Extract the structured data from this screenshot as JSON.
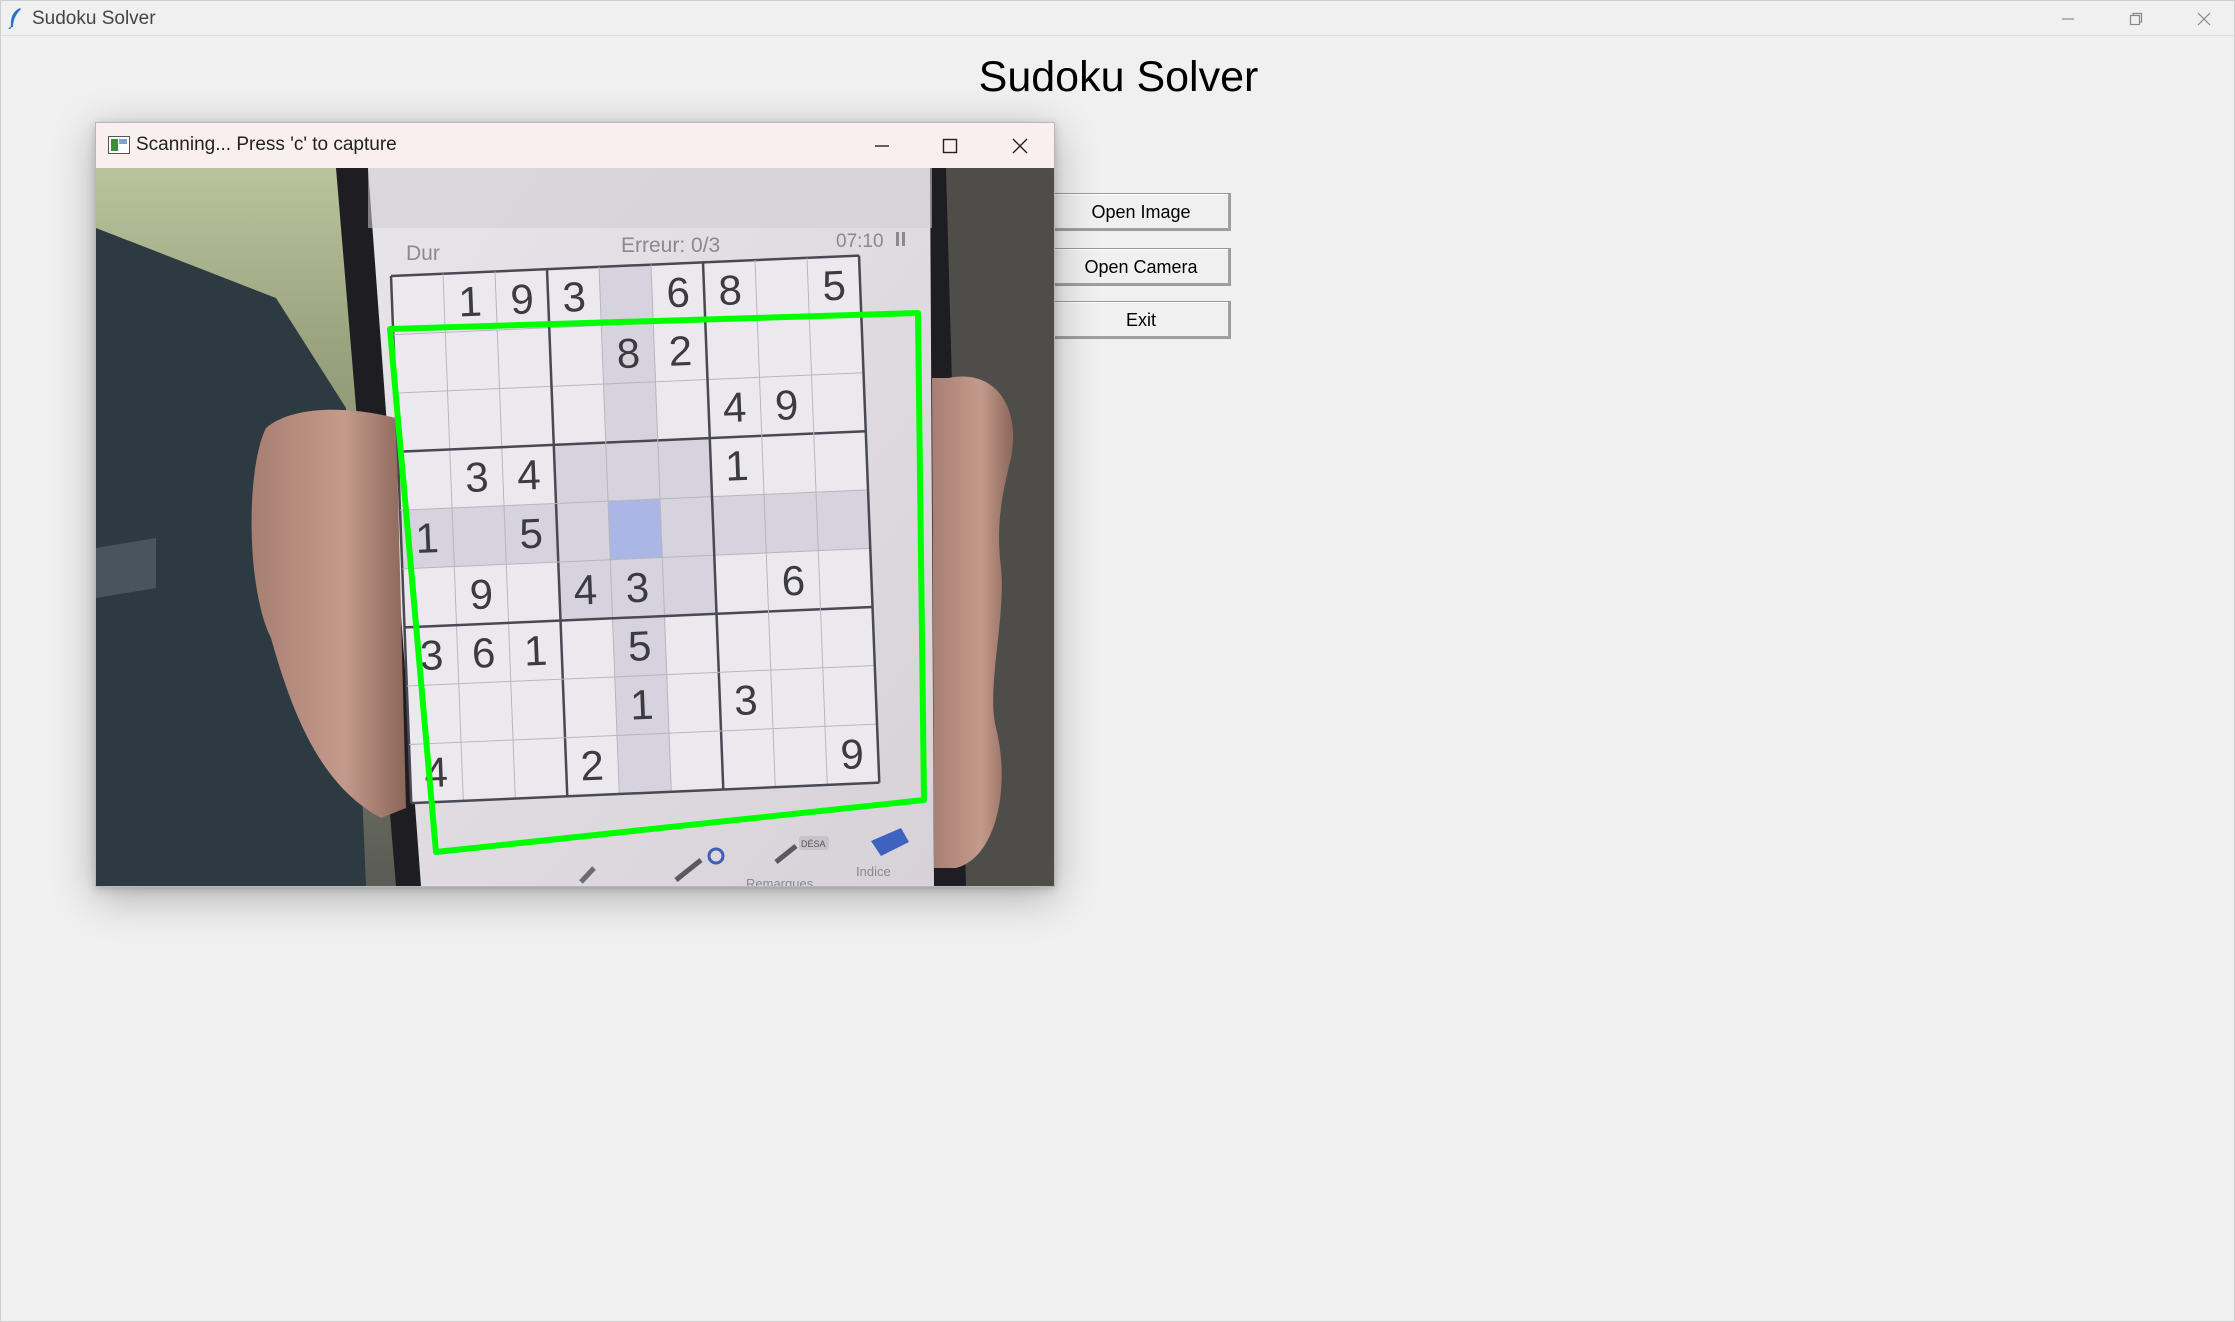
{
  "main_window": {
    "title": "Sudoku Solver",
    "heading": "Sudoku Solver",
    "buttons": {
      "open_image": "Open Image",
      "open_camera": "Open Camera",
      "exit": "Exit"
    }
  },
  "scan_window": {
    "title": "Scanning... Press 'c' to capture"
  },
  "phone_screen": {
    "difficulty": "Dur",
    "errors": "Erreur: 0/3",
    "timer": "07:10",
    "tool_remarques": "Remarques",
    "tool_indice": "Indice",
    "tool_badge": "DÉSA"
  },
  "sudoku_grid": [
    [
      "",
      "1",
      "9",
      "3",
      "",
      "6",
      "8",
      "",
      "5"
    ],
    [
      "",
      "",
      "",
      "",
      "8",
      "2",
      "",
      "",
      ""
    ],
    [
      "",
      "",
      "",
      "",
      "",
      "",
      "4",
      "9",
      ""
    ],
    [
      "",
      "3",
      "4",
      "",
      "",
      "",
      "1",
      "",
      ""
    ],
    [
      "1",
      "",
      "5",
      "",
      "",
      "",
      "",
      "",
      ""
    ],
    [
      "",
      "9",
      "",
      "4",
      "3",
      "",
      "",
      "6",
      ""
    ],
    [
      "3",
      "6",
      "1",
      "",
      "5",
      "",
      "",
      "",
      ""
    ],
    [
      "",
      "",
      "",
      "",
      "1",
      "",
      "3",
      "",
      ""
    ],
    [
      "4",
      "",
      "",
      "2",
      "",
      "",
      "",
      "",
      "9"
    ]
  ],
  "colors": {
    "detection_outline": "#00ff00",
    "window_bg": "#f0f0f0",
    "scan_titlebar_bg": "#f9efef"
  }
}
